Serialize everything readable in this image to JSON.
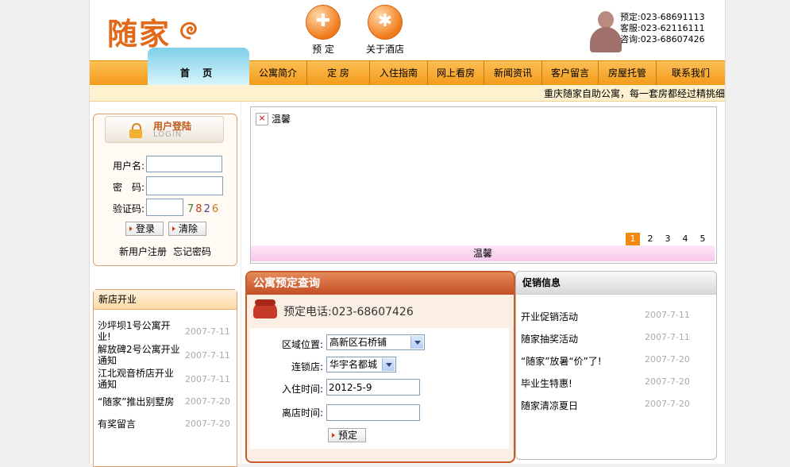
{
  "header": {
    "logo_text": "随家",
    "icons": [
      {
        "label": "预 定",
        "glyph": "✚",
        "icon": "booking-icon"
      },
      {
        "label": "关于酒店",
        "glyph": "✱",
        "icon": "about-hotel-icon"
      }
    ],
    "contact": {
      "booking": "预定:023-68691113",
      "service": "客服:023-62116111",
      "inquiry": "咨询:023-68607426"
    }
  },
  "nav": {
    "home": "首 页",
    "items": [
      "公寓简介",
      "定 房",
      "入住指南",
      "网上看房",
      "新闻资讯",
      "客户留言",
      "房屋托管",
      "联系我们"
    ]
  },
  "ticker": "重庆随家自助公寓，每一套房都经过精挑细",
  "login": {
    "title": "用户登陆",
    "subtitle": "LOGIN",
    "username_label": "用户名:",
    "password_label": "密　码:",
    "captcha_label": "验证码:",
    "captcha_digits": [
      "7",
      "8",
      "2",
      "6"
    ],
    "captcha_colors": [
      "#3a7a3a",
      "#c04020",
      "#5a3a9a",
      "#c07a20"
    ],
    "login_button": "登录",
    "clear_button": "清除",
    "register_link": "新用户注册",
    "forgot_link": "忘记密码"
  },
  "new_stores": {
    "title": "新店开业",
    "items": [
      {
        "title": "沙坪坝1号公寓开业!",
        "date": "2007-7-11"
      },
      {
        "title": "解放碑2号公寓开业通知",
        "date": "2007-7-11"
      },
      {
        "title": "江北观音桥店开业通知",
        "date": "2007-7-11"
      },
      {
        "title": "“随家”推出别墅房",
        "date": "2007-7-20"
      },
      {
        "title": "有奖留言",
        "date": "2007-7-20"
      }
    ]
  },
  "banner": {
    "alt_text": "温馨",
    "caption": "温馨",
    "pages": [
      "1",
      "2",
      "3",
      "4",
      "5"
    ],
    "active_page": "1"
  },
  "reservation": {
    "title": "公寓预定查询",
    "phone_text": "预定电话:023-68607426",
    "area_label": "区域位置:",
    "area_value": "高新区石桥铺",
    "chain_label": "连锁店:",
    "chain_value": "华宇名都城",
    "checkin_label": "入住时间:",
    "checkin_value": "2012-5-9",
    "checkout_label": "离店时间:",
    "checkout_value": "",
    "submit_button": "预定"
  },
  "promotions": {
    "title": "促销信息",
    "items": [
      {
        "title": "开业促销活动",
        "date": "2007-7-11"
      },
      {
        "title": "随家抽奖活动",
        "date": "2007-7-11"
      },
      {
        "title": "“随家”放暑“价”了!",
        "date": "2007-7-20"
      },
      {
        "title": "毕业生特惠!",
        "date": "2007-7-20"
      },
      {
        "title": "随家清凉夏日",
        "date": "2007-7-20"
      }
    ]
  }
}
